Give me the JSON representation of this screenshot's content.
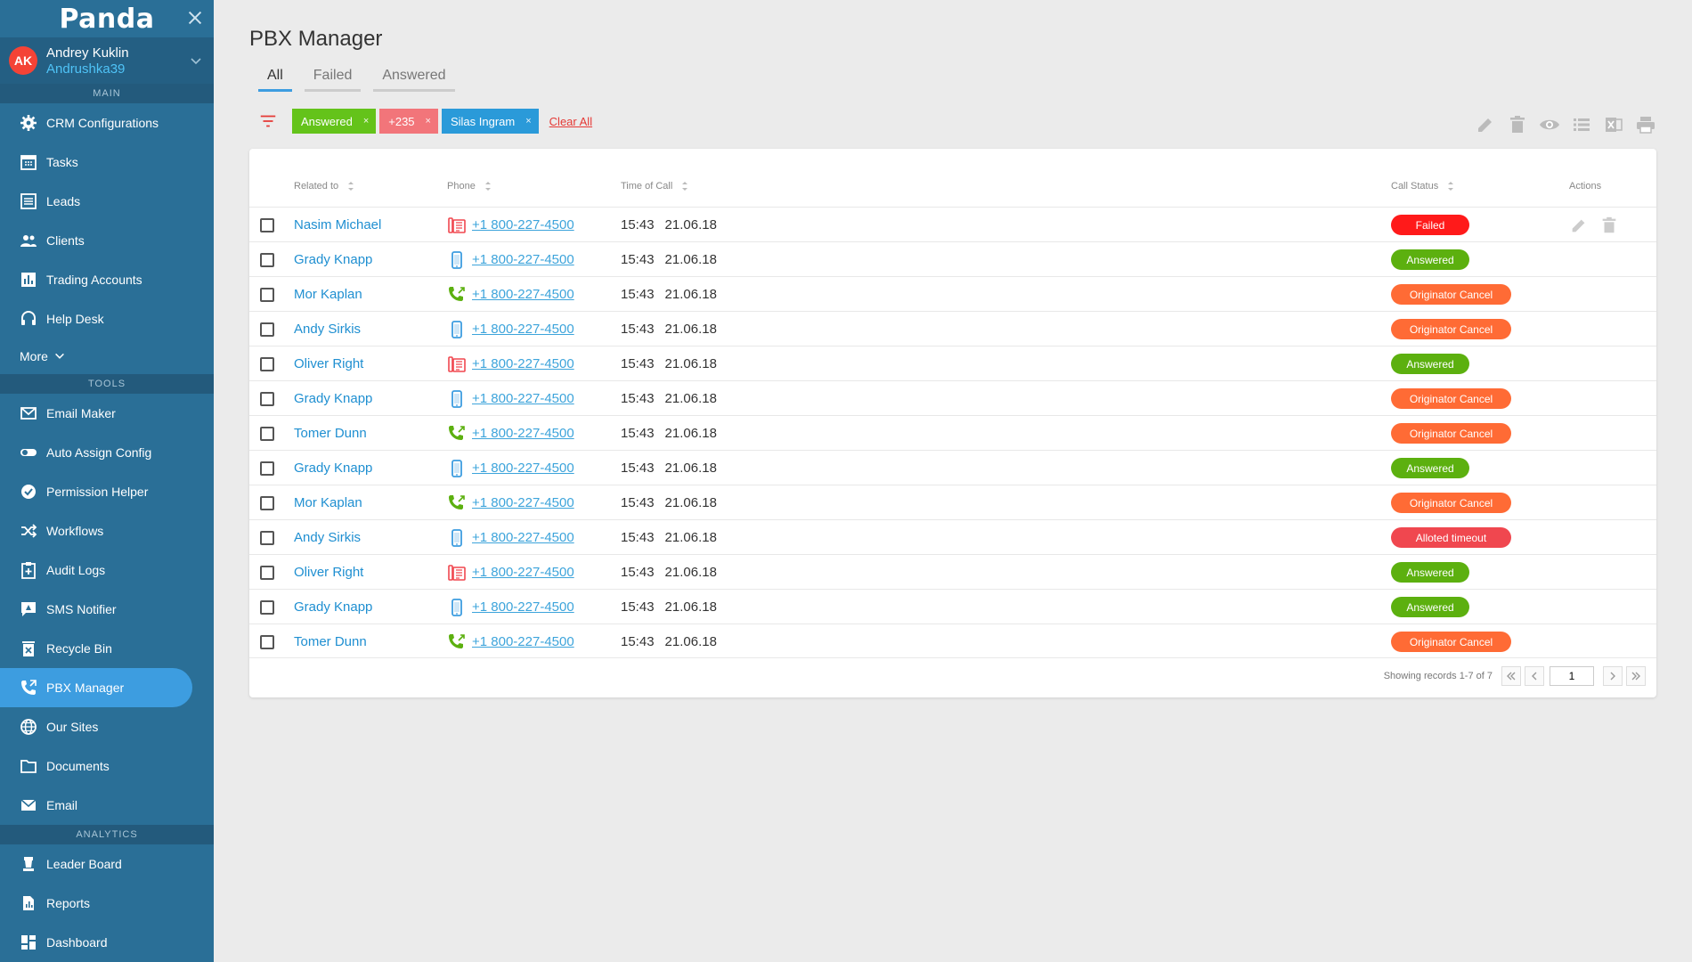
{
  "brand": {
    "logo": "Panda"
  },
  "user": {
    "initials": "AK",
    "name": "Andrey Kuklin",
    "handle": "Andrushka39"
  },
  "sidebar": {
    "sections": {
      "main": "MAIN",
      "tools": "TOOLS",
      "analytics": "ANALYTICS"
    },
    "main_items": [
      {
        "label": "CRM Configurations",
        "icon": "gear-icon"
      },
      {
        "label": "Tasks",
        "icon": "calendar-icon"
      },
      {
        "label": "Leads",
        "icon": "list-icon"
      },
      {
        "label": "Clients",
        "icon": "people-icon"
      },
      {
        "label": "Trading Accounts",
        "icon": "bar-chart-icon"
      },
      {
        "label": "Help Desk",
        "icon": "headset-icon"
      }
    ],
    "more": "More",
    "tools_items": [
      {
        "label": "Email Maker",
        "icon": "envelope-icon"
      },
      {
        "label": "Auto Assign Config",
        "icon": "toggle-icon"
      },
      {
        "label": "Permission Helper",
        "icon": "check-circle-icon"
      },
      {
        "label": "Workflows",
        "icon": "shuffle-icon"
      },
      {
        "label": "Audit Logs",
        "icon": "clipboard-icon"
      },
      {
        "label": "SMS Notifier",
        "icon": "sms-icon"
      },
      {
        "label": "Recycle Bin",
        "icon": "trash-icon"
      },
      {
        "label": "PBX Manager",
        "icon": "phone-forward-icon",
        "active": true
      },
      {
        "label": "Our Sites",
        "icon": "globe-icon"
      },
      {
        "label": "Documents",
        "icon": "folder-icon"
      },
      {
        "label": "Email",
        "icon": "mail-icon"
      }
    ],
    "analytics_items": [
      {
        "label": "Leader Board",
        "icon": "chess-icon"
      },
      {
        "label": "Reports",
        "icon": "report-icon"
      },
      {
        "label": "Dashboard",
        "icon": "dashboard-icon"
      }
    ]
  },
  "page": {
    "title": "PBX Manager"
  },
  "tabs": [
    {
      "label": "All",
      "active": true
    },
    {
      "label": "Failed"
    },
    {
      "label": "Answered"
    }
  ],
  "filters": {
    "chips": [
      {
        "label": "Answered",
        "color": "#64c31a"
      },
      {
        "label": "+235",
        "color": "#f2757a"
      },
      {
        "label": "Silas Ingram",
        "color": "#2a9ad9"
      }
    ],
    "clear_all": "Clear All",
    "remove_symbol": "×"
  },
  "table": {
    "headers": {
      "related_to": "Related to",
      "phone": "Phone",
      "time_of_call": "Time of Call",
      "call_status": "Call Status",
      "actions": "Actions"
    },
    "rows": [
      {
        "related": "Nasim Michael",
        "phone_type": "fax",
        "phone": "+1 800-227-4500",
        "time": "15:43",
        "date": "21.06.18",
        "status": "Failed",
        "status_kind": "failed",
        "actions": true
      },
      {
        "related": "Grady Knapp",
        "phone_type": "mobile",
        "phone": "+1 800-227-4500",
        "time": "15:43",
        "date": "21.06.18",
        "status": "Answered",
        "status_kind": "answered"
      },
      {
        "related": "Mor Kaplan",
        "phone_type": "landline",
        "phone": "+1 800-227-4500",
        "time": "15:43",
        "date": "21.06.18",
        "status": "Originator Cancel",
        "status_kind": "cancel"
      },
      {
        "related": "Andy Sirkis",
        "phone_type": "mobile",
        "phone": "+1 800-227-4500",
        "time": "15:43",
        "date": "21.06.18",
        "status": "Originator Cancel",
        "status_kind": "cancel"
      },
      {
        "related": "Oliver Right",
        "phone_type": "fax",
        "phone": "+1 800-227-4500",
        "time": "15:43",
        "date": "21.06.18",
        "status": "Answered",
        "status_kind": "answered"
      },
      {
        "related": "Grady Knapp",
        "phone_type": "mobile",
        "phone": "+1 800-227-4500",
        "time": "15:43",
        "date": "21.06.18",
        "status": "Originator Cancel",
        "status_kind": "cancel"
      },
      {
        "related": "Tomer Dunn",
        "phone_type": "landline",
        "phone": "+1 800-227-4500",
        "time": "15:43",
        "date": "21.06.18",
        "status": "Originator Cancel",
        "status_kind": "cancel"
      },
      {
        "related": "Grady Knapp",
        "phone_type": "mobile",
        "phone": "+1 800-227-4500",
        "time": "15:43",
        "date": "21.06.18",
        "status": "Answered",
        "status_kind": "answered"
      },
      {
        "related": "Mor Kaplan",
        "phone_type": "landline",
        "phone": "+1 800-227-4500",
        "time": "15:43",
        "date": "21.06.18",
        "status": "Originator Cancel",
        "status_kind": "cancel"
      },
      {
        "related": "Andy Sirkis",
        "phone_type": "mobile",
        "phone": "+1 800-227-4500",
        "time": "15:43",
        "date": "21.06.18",
        "status": "Alloted timeout",
        "status_kind": "timeout"
      },
      {
        "related": "Oliver Right",
        "phone_type": "fax",
        "phone": "+1 800-227-4500",
        "time": "15:43",
        "date": "21.06.18",
        "status": "Answered",
        "status_kind": "answered"
      },
      {
        "related": "Grady Knapp",
        "phone_type": "mobile",
        "phone": "+1 800-227-4500",
        "time": "15:43",
        "date": "21.06.18",
        "status": "Answered",
        "status_kind": "answered"
      },
      {
        "related": "Tomer Dunn",
        "phone_type": "landline",
        "phone": "+1 800-227-4500",
        "time": "15:43",
        "date": "21.06.18",
        "status": "Originator Cancel",
        "status_kind": "cancel"
      }
    ]
  },
  "pagination": {
    "summary": "Showing records 1-7 of 7",
    "page": "1"
  },
  "colors": {
    "sidebar": "#2a6f97",
    "accent": "#3d9de0",
    "failed": "#ff1a1a",
    "answered": "#5cb00f",
    "cancel": "#ff6b35",
    "timeout": "#f0474f"
  }
}
